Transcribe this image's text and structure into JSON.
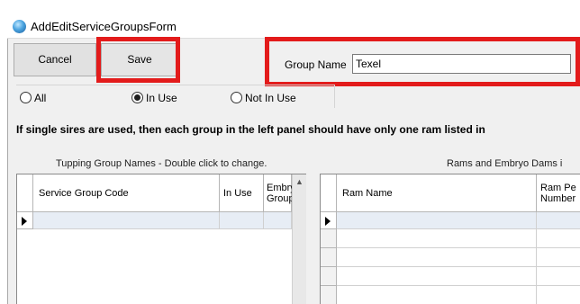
{
  "window": {
    "title": "AddEditServiceGroupsForm",
    "icon": "app-globe-icon"
  },
  "toolbar": {
    "cancel_label": "Cancel",
    "save_label": "Save"
  },
  "group_name": {
    "label": "Group Name",
    "value": "Texel"
  },
  "filter": {
    "options": [
      {
        "label": "All",
        "selected": false
      },
      {
        "label": "In Use",
        "selected": true
      },
      {
        "label": "Not In Use",
        "selected": false
      }
    ]
  },
  "info_text": "If single sires are used, then each group in the left panel should have only one ram listed in",
  "left_panel": {
    "caption": "Tupping Group Names - Double click to change.",
    "columns": [
      "Service Group Code",
      "In Use",
      "Embryo Group"
    ]
  },
  "right_panel": {
    "caption": "Rams and Embryo Dams i",
    "columns": [
      "Ram Name",
      "Ram Pe Number"
    ]
  },
  "colors": {
    "highlight": "#e31b1b",
    "new_row": "#e7edf5"
  }
}
